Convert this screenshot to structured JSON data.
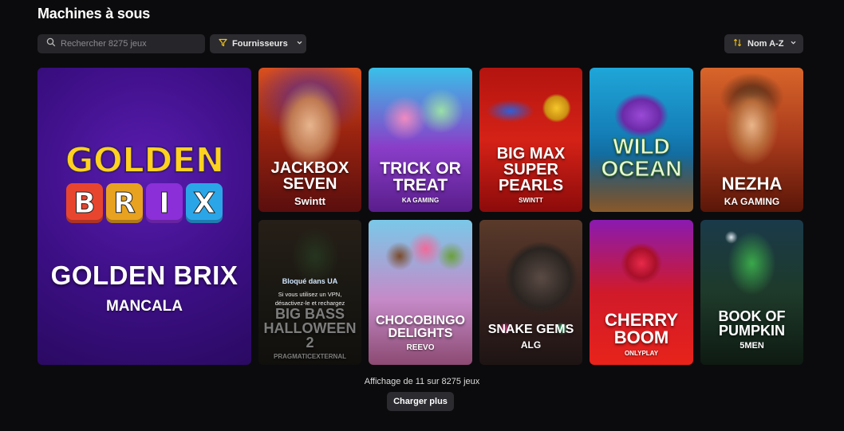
{
  "page": {
    "title": "Machines à sous"
  },
  "search": {
    "placeholder": "Rechercher 8275 jeux"
  },
  "filters": {
    "providers_label": "Fournisseurs",
    "sort_label": "Nom A-Z"
  },
  "featured": {
    "name": "GOLDEN BRIX",
    "provider": "MANCALA",
    "logo_top": "GOLDEN",
    "logo_letters": [
      "B",
      "R",
      "I",
      "X"
    ]
  },
  "games": [
    {
      "name": "JACKBOX SEVEN",
      "provider": "Swintt"
    },
    {
      "name": "TRICK OR TREAT",
      "provider": "KA GAMING"
    },
    {
      "name": "BIG MAX SUPER PEARLS",
      "provider": "SWINTT"
    },
    {
      "name": "WILD OCEAN",
      "provider": ""
    },
    {
      "name": "NEZHA",
      "provider": "KA GAMING"
    },
    {
      "name": "BIG BASS HALLOWEEN 2",
      "provider": "PRAGMATICEXTERNAL",
      "blocked_title": "Bloqué dans UA",
      "blocked_message": "Si vous utilisez un VPN, désactivez-le et rechargez"
    },
    {
      "name": "CHOCOBINGO DELIGHTS",
      "provider": "REEVO"
    },
    {
      "name": "SNAKE GEMS",
      "provider": "ALG"
    },
    {
      "name": "CHERRY BOOM",
      "provider": "ONLYPLAY"
    },
    {
      "name": "BOOK OF PUMPKIN",
      "provider": "5MEN"
    }
  ],
  "footer": {
    "count_text": "Affichage de 11 sur 8275 jeux",
    "load_more": "Charger plus"
  }
}
